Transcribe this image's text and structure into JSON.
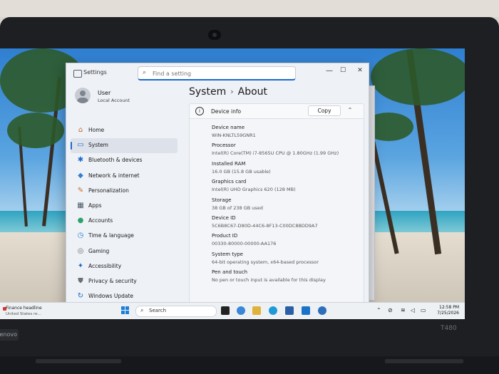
{
  "window": {
    "app_title": "Settings",
    "search_placeholder": "Find a setting",
    "controls": {
      "minimize": "—",
      "maximize": "☐",
      "close": "✕"
    }
  },
  "user": {
    "name": "User",
    "subtitle": "Local Account"
  },
  "sidebar": {
    "items": [
      {
        "label": "Home",
        "icon": "home-icon",
        "glyph": "⌂",
        "color": "#c4672f"
      },
      {
        "label": "System",
        "icon": "system-icon",
        "glyph": "▭",
        "color": "#1b6ac9",
        "active": true
      },
      {
        "label": "Bluetooth & devices",
        "icon": "bluetooth-icon",
        "glyph": "✱",
        "color": "#1b6ac9"
      },
      {
        "label": "Network & internet",
        "icon": "network-icon",
        "glyph": "◆",
        "color": "#2f7fd2"
      },
      {
        "label": "Personalization",
        "icon": "brush-icon",
        "glyph": "✎",
        "color": "#c76a2b"
      },
      {
        "label": "Apps",
        "icon": "apps-icon",
        "glyph": "▦",
        "color": "#4a5866"
      },
      {
        "label": "Accounts",
        "icon": "accounts-icon",
        "glyph": "●",
        "color": "#2aa36b"
      },
      {
        "label": "Time & language",
        "icon": "time-language-icon",
        "glyph": "◷",
        "color": "#2f7fd2"
      },
      {
        "label": "Gaming",
        "icon": "gaming-icon",
        "glyph": "◎",
        "color": "#6b7078"
      },
      {
        "label": "Accessibility",
        "icon": "accessibility-icon",
        "glyph": "✦",
        "color": "#1b6ac9"
      },
      {
        "label": "Privacy & security",
        "icon": "shield-icon",
        "glyph": "⛊",
        "color": "#6b7078"
      },
      {
        "label": "Windows Update",
        "icon": "windows-update-icon",
        "glyph": "↻",
        "color": "#1b6ac9"
      }
    ]
  },
  "breadcrumb": {
    "parent": "System",
    "separator": "›",
    "current": "About"
  },
  "device_info": {
    "title": "Device info",
    "copy_label": "Copy",
    "collapse_glyph": "⌃",
    "specs": [
      {
        "label": "Device name",
        "value": "WIN-KNLTL59GNR1"
      },
      {
        "label": "Processor",
        "value": "Intel(R) Core(TM) i7-8565U CPU @ 1.80GHz (1.99 GHz)"
      },
      {
        "label": "Installed RAM",
        "value": "16.0 GB (15.8 GB usable)"
      },
      {
        "label": "Graphics card",
        "value": "Intel(R) UHD Graphics 620 (128 MB)"
      },
      {
        "label": "Storage",
        "value": "38 GB of 238 GB used"
      },
      {
        "label": "Device ID",
        "value": "5C6B8C67-D80D-44C6-8F13-C00DC8BDD9A7"
      },
      {
        "label": "Product ID",
        "value": "00330-80000-00000-AA176"
      },
      {
        "label": "System type",
        "value": "64-bit operating system, x64-based processor"
      },
      {
        "label": "Pen and touch",
        "value": "No pen or touch input is available for this display"
      }
    ]
  },
  "taskbar": {
    "news_headline": "Finance headline",
    "news_sub": "United States re...",
    "search_label": "Search",
    "time": "12:58 PM",
    "date": "7/25/2026"
  },
  "hardware": {
    "brand": "lenovo",
    "model": "T480"
  }
}
